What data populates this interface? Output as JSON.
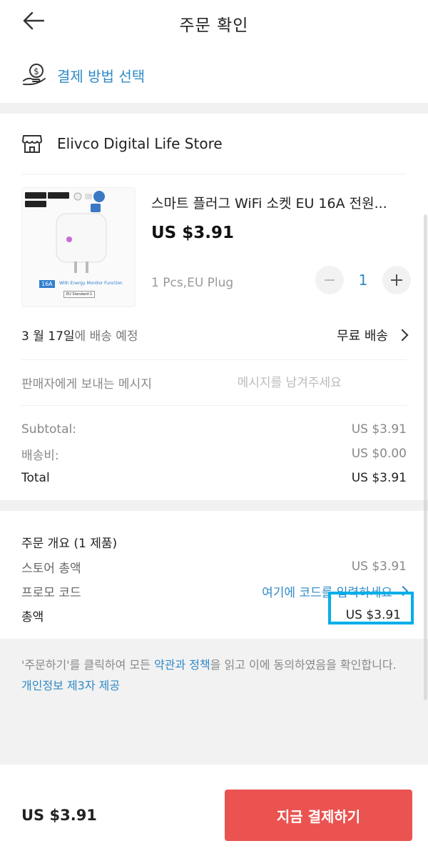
{
  "header": {
    "title": "주문 확인"
  },
  "payment": {
    "label": "결제 방법 선택"
  },
  "store": {
    "name": "Elivco Digital Life Store"
  },
  "product": {
    "title": "스마트 플러그 WiFi 소켓 EU 16A 전원...",
    "price": "US $3.91",
    "variant": "1 Pcs,EU Plug",
    "quantity": "1",
    "thumb_badge": "16A",
    "thumb_caption": "With Energy Monitor Function",
    "thumb_standard": "EU Standard-1"
  },
  "shipping": {
    "date": "3 월 17일",
    "date_suffix": "에 배송 예정",
    "method": "무료 배송"
  },
  "message": {
    "label": "판매자에게 보내는 메시지",
    "placeholder": "메시지를 남겨주세요"
  },
  "summary": {
    "rows": [
      {
        "label": "Subtotal:",
        "value": "US $3.91"
      },
      {
        "label": "배송비:",
        "value": "US $0.00"
      },
      {
        "label": "Total",
        "value": "US $3.91"
      }
    ]
  },
  "overview": {
    "title": "주문 개요 (1 제품)",
    "store_total_label": "스토어 총액",
    "store_total_value": "US $3.91",
    "promo_label": "프로모 코드",
    "promo_link": "여기에 코드를 입력하세요",
    "grand_label": "총액",
    "grand_value": "US $3.91"
  },
  "terms": {
    "prefix": "'주문하기'를 클릭하여 모든 ",
    "link": "약관과 정책",
    "suffix": "을 읽고 이에 동의하였음을 확인합니다.",
    "privacy_link": "개인정보 제3자 제공"
  },
  "footer": {
    "total": "US $3.91",
    "button": "지금 결제하기"
  },
  "colors": {
    "accent": "#2f8ac7",
    "primary_button": "#ea5350",
    "highlight_box": "#00aeea"
  }
}
